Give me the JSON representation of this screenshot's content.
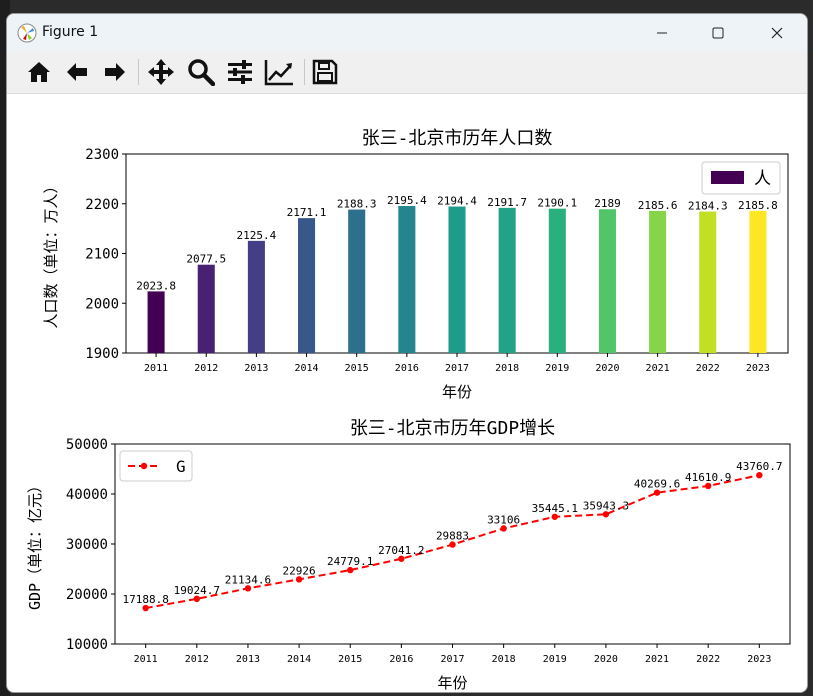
{
  "window": {
    "title": "Figure 1"
  },
  "toolbar": {
    "tools": [
      {
        "icon": "home-icon"
      },
      {
        "icon": "back-icon"
      },
      {
        "icon": "forward-icon"
      },
      {
        "icon": "pan-icon"
      },
      {
        "icon": "zoom-icon"
      },
      {
        "icon": "configure-subplots-icon"
      },
      {
        "icon": "edit-axis-icon"
      },
      {
        "icon": "save-icon"
      }
    ]
  },
  "chart_data": [
    {
      "type": "bar",
      "title": "张三-北京市历年人口数",
      "xlabel": "年份",
      "ylabel": "人口数（单位：万人）",
      "categories": [
        "2011",
        "2012",
        "2013",
        "2014",
        "2015",
        "2016",
        "2017",
        "2018",
        "2019",
        "2020",
        "2021",
        "2022",
        "2023"
      ],
      "values": [
        2023.8,
        2077.5,
        2125.4,
        2171.1,
        2188.3,
        2195.4,
        2194.4,
        2191.7,
        2190.1,
        2189,
        2185.6,
        2184.3,
        2185.8
      ],
      "value_labels": [
        "2023.8",
        "2077.5",
        "2125.4",
        "2171.1",
        "2188.3",
        "2195.4",
        "2194.4",
        "2191.7",
        "2190.1",
        "2189",
        "2185.6",
        "2184.3",
        "2185.8"
      ],
      "ylim": [
        1900,
        2300
      ],
      "yticks": [
        "1900",
        "2000",
        "2100",
        "2200",
        "2300"
      ],
      "colors": [
        "#440154",
        "#482173",
        "#433e85",
        "#38588c",
        "#2d708e",
        "#25858e",
        "#1e9b8a",
        "#2ab07f",
        "#52c569",
        "#86d549",
        "#c2df23",
        "#fde725"
      ],
      "bar_colors": [
        "#440154",
        "#482173",
        "#433e85",
        "#38588c",
        "#2d708e",
        "#25858e",
        "#1e9b8a",
        "#20a386",
        "#2ab07f",
        "#52c569",
        "#86d549",
        "#c2df23",
        "#fde725"
      ],
      "legend": {
        "label": "人",
        "placement": "top-right"
      },
      "grid": false
    },
    {
      "type": "line",
      "title": "张三-北京市历年GDP增长",
      "xlabel": "年份",
      "ylabel": "GDP（单位：亿元）",
      "categories": [
        "2011",
        "2012",
        "2013",
        "2014",
        "2015",
        "2016",
        "2017",
        "2018",
        "2019",
        "2020",
        "2021",
        "2022",
        "2023"
      ],
      "values": [
        17188.8,
        19024.7,
        21134.6,
        22926,
        24779.1,
        27041.2,
        29883,
        33106,
        35445.1,
        35943.3,
        40269.6,
        41610.9,
        43760.7
      ],
      "value_labels": [
        "17188.8",
        "19024.7",
        "21134.6",
        "22926",
        "24779.1",
        "27041.2",
        "29883",
        "33106",
        "35445.1",
        "35943.3",
        "40269.6",
        "41610.9",
        "43760.7"
      ],
      "ylim": [
        10000,
        50000
      ],
      "yticks": [
        "10000",
        "20000",
        "30000",
        "40000",
        "50000"
      ],
      "line_color": "#ff0000",
      "line_style": "dashed",
      "marker": "circle",
      "legend": {
        "label": "G",
        "placement": "top-left"
      },
      "grid": false
    }
  ]
}
